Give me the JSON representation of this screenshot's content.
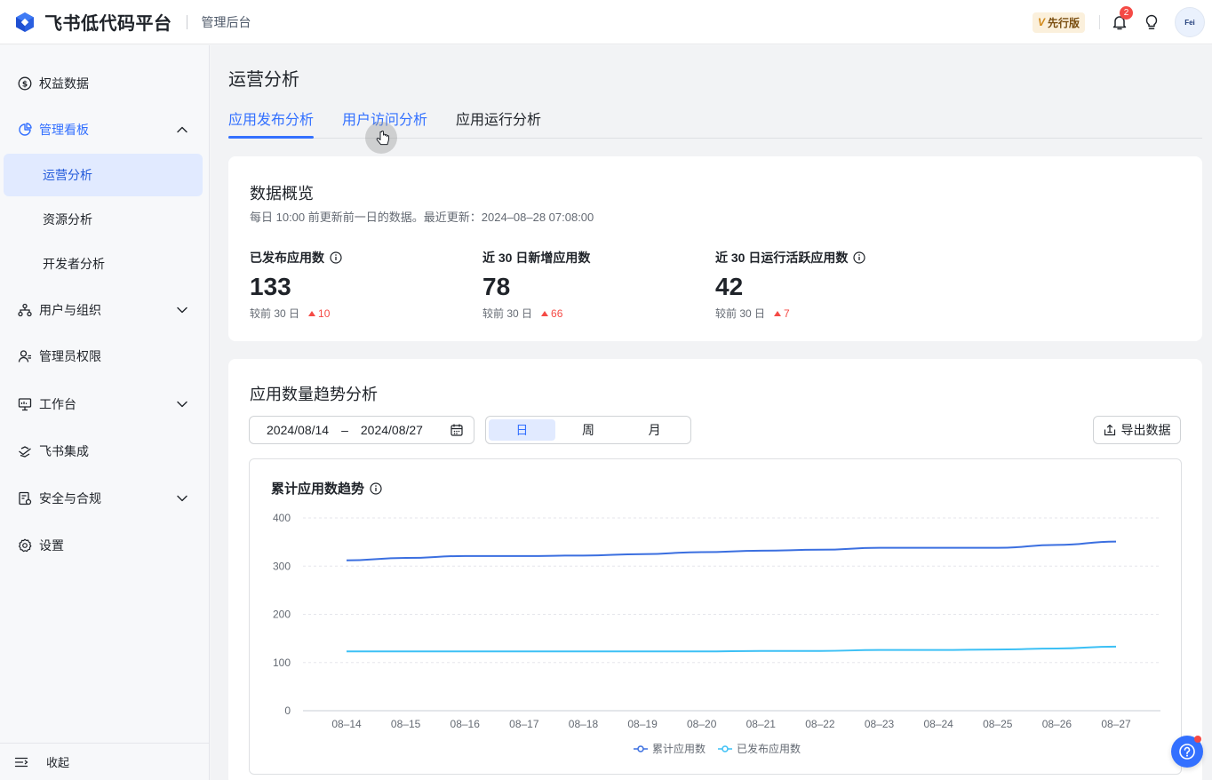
{
  "topbar": {
    "app_title": "飞书低代码平台",
    "sub_title": "管理后台",
    "version_label": "先行版",
    "version_mark": "V",
    "notification_count": "2",
    "avatar_text": "Fei"
  },
  "sidebar": {
    "items": [
      {
        "label": "权益数据",
        "icon": "dollar-circle-icon"
      },
      {
        "label": "管理看板",
        "icon": "pie-chart-icon",
        "expanded": true
      },
      {
        "label": "运营分析",
        "active": true
      },
      {
        "label": "资源分析"
      },
      {
        "label": "开发者分析"
      },
      {
        "label": "用户与组织",
        "icon": "org-tree-icon"
      },
      {
        "label": "管理员权限",
        "icon": "admin-user-icon"
      },
      {
        "label": "工作台",
        "icon": "monitor-icon"
      },
      {
        "label": "飞书集成",
        "icon": "integration-icon"
      },
      {
        "label": "安全与合规",
        "icon": "security-doc-icon"
      },
      {
        "label": "设置",
        "icon": "gear-icon"
      }
    ],
    "collapse_label": "收起"
  },
  "main": {
    "page_title": "运营分析",
    "tabs": [
      {
        "label": "应用发布分析",
        "active": true
      },
      {
        "label": "用户访问分析"
      },
      {
        "label": "应用运行分析"
      }
    ]
  },
  "overview": {
    "title": "数据概览",
    "desc": "每日 10:00 前更新前一日的数据。最近更新：2024–08–28 07:08:00",
    "metrics": [
      {
        "label": "已发布应用数",
        "value": "133",
        "cmp": "较前 30 日",
        "delta": "10"
      },
      {
        "label": "近 30 日新增应用数",
        "value": "78",
        "cmp": "较前 30 日",
        "delta": "66"
      },
      {
        "label": "近 30 日运行活跃应用数",
        "value": "42",
        "cmp": "较前 30 日",
        "delta": "7"
      }
    ]
  },
  "trend": {
    "title": "应用数量趋势分析",
    "date_start": "2024/08/14",
    "date_sep": "–",
    "date_end": "2024/08/27",
    "granularity": [
      "日",
      "周",
      "月"
    ],
    "export_label": "导出数据"
  },
  "chart_data": {
    "type": "line",
    "title": "累计应用数趋势",
    "x": [
      "08–14",
      "08–15",
      "08–16",
      "08–17",
      "08–18",
      "08–19",
      "08–20",
      "08–21",
      "08–22",
      "08–23",
      "08–24",
      "08–25",
      "08–26",
      "08–27"
    ],
    "ylim": [
      0,
      400
    ],
    "yticks": [
      "400",
      "300",
      "200",
      "100",
      "0"
    ],
    "series": [
      {
        "name": "累计应用数",
        "color": "#3b6fe0",
        "values": [
          312,
          317,
          321,
          321,
          322,
          325,
          329,
          332,
          334,
          338,
          338,
          338,
          344,
          351
        ]
      },
      {
        "name": "已发布应用数",
        "color": "#3cc0f5",
        "values": [
          123,
          123,
          123,
          123,
          123,
          123,
          123,
          124,
          124,
          126,
          126,
          127,
          129,
          133
        ]
      }
    ],
    "legend": "bottom",
    "grid": true
  }
}
